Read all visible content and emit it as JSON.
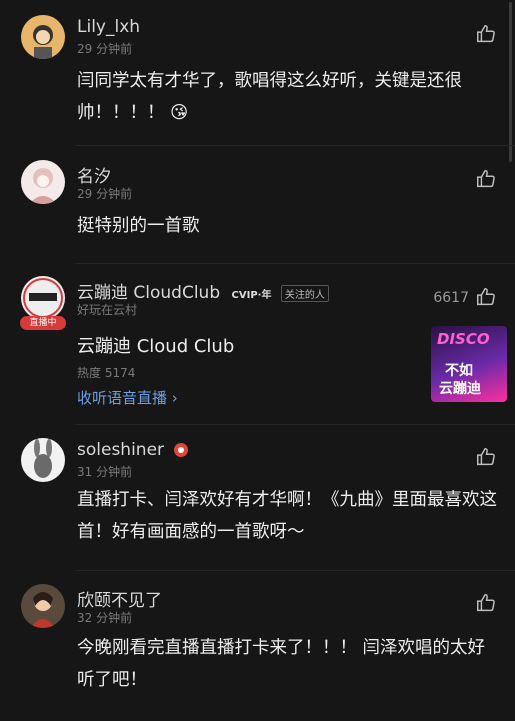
{
  "comments": [
    {
      "user": "Lily_lxh",
      "time": "29 分钟前",
      "text": "闫同学太有才华了，歌唱得这么好听，关键是还很帅！！！！ 😘",
      "avatar_colors": [
        "#f1c68a",
        "#444"
      ]
    },
    {
      "user": "名汐",
      "time": "29 分钟前",
      "text": "挺特别的一首歌",
      "avatar_colors": [
        "#f3e3e3",
        "#d9a8a8"
      ]
    },
    {
      "user": "云蹦迪 CloudClub",
      "subtitle": "好玩在云村",
      "vip_label": "CVIP·年",
      "tag_label": "关注的人",
      "live_badge": "直播中",
      "likes": "6617",
      "card": {
        "title": "云蹦迪 Cloud Club",
        "heat": "热度 5174",
        "link": "收听语音直播 ›",
        "cover_top": "DISCO",
        "cover_mid": "不如",
        "cover_bot": "云蹦迪"
      }
    },
    {
      "user": "soleshiner",
      "time": "31 分钟前",
      "text": "直播打卡、闫泽欢好有才华啊！《九曲》里面最喜欢这首！好有画面感的一首歌呀～"
    },
    {
      "user": "欣颐不见了",
      "time": "32 分钟前",
      "text": "今晚刚看完直播直播打卡来了！！！ 闫泽欢唱的太好听了吧！"
    }
  ],
  "colors": {
    "background": "#161616",
    "link": "#6f9de0",
    "live_badge": "#d63a3a"
  }
}
